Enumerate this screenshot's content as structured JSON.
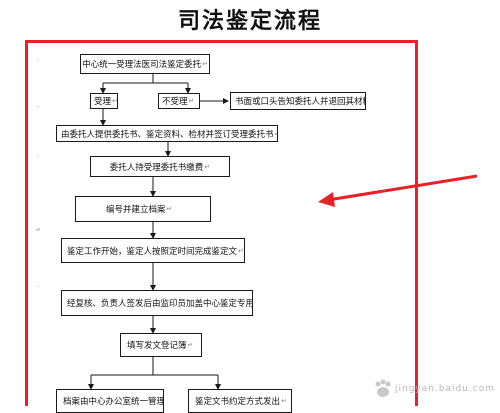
{
  "title": "司法鉴定流程",
  "colors": {
    "frame": "#e8202a",
    "pointer_arrow": "#e8202a",
    "box_border": "#1a1a1a"
  },
  "para_mark": "↵",
  "nodes": {
    "n1": "中心统一受理法医司法鉴定委托",
    "n_accept": "受理",
    "n_reject": "不受理",
    "n_notify": "书面或口头告知委托人并退回其材料",
    "n2": "由委托人提供委托书、鉴定资料、检材并签订受理委托书",
    "n3": "委托人持受理委托书缴费",
    "n4": "编号并建立档案",
    "n5": "鉴定工作开始，鉴定人按照定时间完成鉴定文",
    "n6": "经复核、负责人签发后由监印员加盖中心鉴定专用章",
    "n7": "填写发文登记簿",
    "n8": "档案由中心办公室统一管理",
    "n9": "鉴定文书约定方式发出"
  },
  "watermark": {
    "text": "jingyan.baidu.com",
    "icon": "baidu-paw-icon"
  }
}
